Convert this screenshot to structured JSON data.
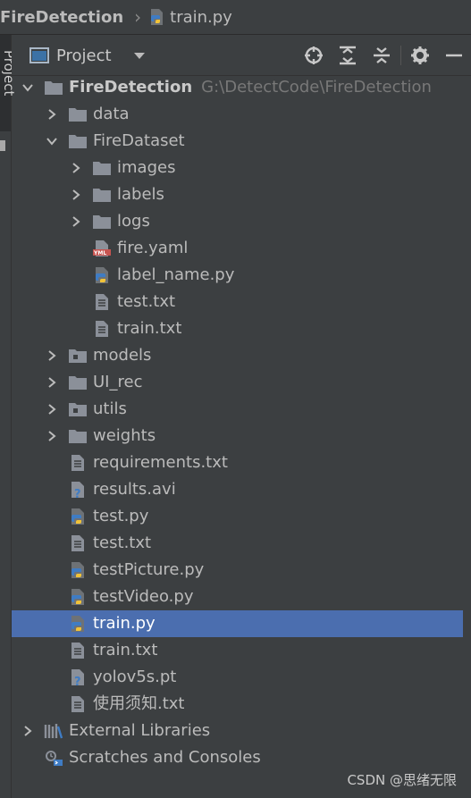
{
  "breadcrumb": {
    "project": "FireDetection",
    "file": "train.py",
    "file_icon": "python-file-icon"
  },
  "tool_strip": {
    "tab_label": "Project"
  },
  "panel": {
    "title": "Project",
    "tools": [
      "locate-icon",
      "expand-all-icon",
      "collapse-all-icon",
      "gear-icon",
      "minimize-icon"
    ]
  },
  "tree": {
    "root": {
      "label": "FireDetection",
      "path": "G:\\DetectCode\\FireDetection"
    },
    "items": [
      {
        "label": "data",
        "type": "folder",
        "icon": "folder-icon"
      },
      {
        "label": "FireDataset",
        "type": "folder",
        "icon": "folder-icon",
        "expanded": true
      },
      {
        "label": "images",
        "type": "folder",
        "icon": "folder-icon"
      },
      {
        "label": "labels",
        "type": "folder",
        "icon": "folder-icon"
      },
      {
        "label": "logs",
        "type": "folder",
        "icon": "folder-icon"
      },
      {
        "label": "fire.yaml",
        "type": "file",
        "icon": "yaml-file-icon"
      },
      {
        "label": "label_name.py",
        "type": "file",
        "icon": "python-file-icon"
      },
      {
        "label": "test.txt",
        "type": "file",
        "icon": "text-file-icon"
      },
      {
        "label": "train.txt",
        "type": "file",
        "icon": "text-file-icon"
      },
      {
        "label": "models",
        "type": "folder",
        "icon": "package-folder-icon"
      },
      {
        "label": "UI_rec",
        "type": "folder",
        "icon": "folder-icon"
      },
      {
        "label": "utils",
        "type": "folder",
        "icon": "package-folder-icon"
      },
      {
        "label": "weights",
        "type": "folder",
        "icon": "folder-icon"
      },
      {
        "label": "requirements.txt",
        "type": "file",
        "icon": "text-file-icon"
      },
      {
        "label": "results.avi",
        "type": "file",
        "icon": "unknown-file-icon"
      },
      {
        "label": "test.py",
        "type": "file",
        "icon": "python-file-icon"
      },
      {
        "label": "test.txt",
        "type": "file",
        "icon": "text-file-icon"
      },
      {
        "label": "testPicture.py",
        "type": "file",
        "icon": "python-file-icon"
      },
      {
        "label": "testVideo.py",
        "type": "file",
        "icon": "python-file-icon"
      },
      {
        "label": "train.py",
        "type": "file",
        "icon": "python-file-icon",
        "selected": true
      },
      {
        "label": "train.txt",
        "type": "file",
        "icon": "text-file-icon"
      },
      {
        "label": "yolov5s.pt",
        "type": "file",
        "icon": "unknown-file-icon"
      },
      {
        "label": "使用须知.txt",
        "type": "file",
        "icon": "text-file-icon"
      }
    ],
    "external_libraries": "External Libraries",
    "scratches": "Scratches and Consoles"
  },
  "watermark": "CSDN @思绪无限",
  "colors": {
    "background": "#3c3f41",
    "selection": "#4b6eaf",
    "text": "#bbbbbb",
    "folder": "#8b9099",
    "python_blue": "#3f7cc4",
    "python_yellow": "#f1c338"
  }
}
